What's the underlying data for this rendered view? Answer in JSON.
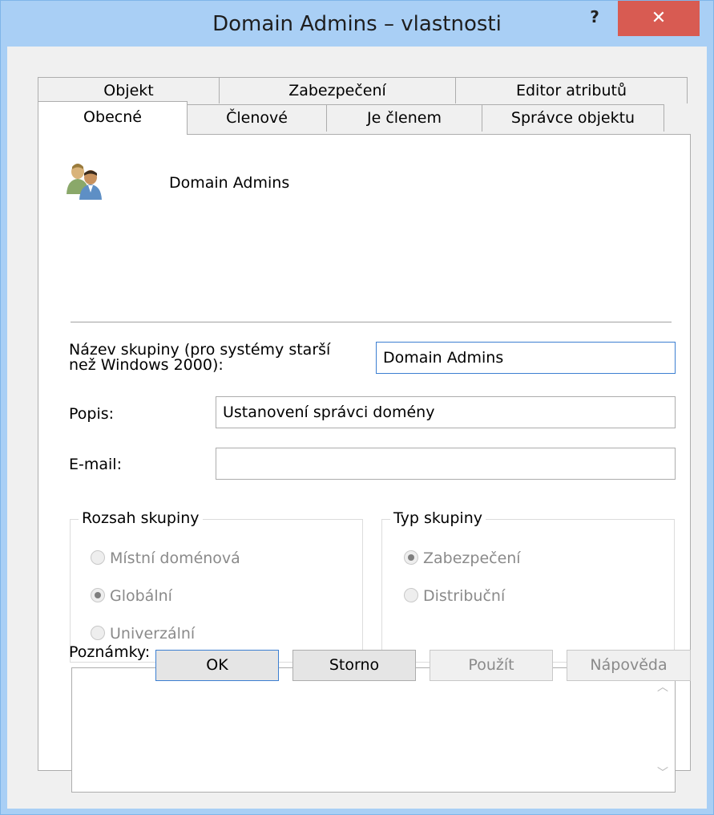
{
  "window": {
    "title": "Domain Admins – vlastnosti",
    "help_label": "?",
    "close_label": "✕"
  },
  "tabs": {
    "row1": [
      "Objekt",
      "Zabezpečení",
      "Editor atributů"
    ],
    "row2": [
      "Obecné",
      "Členové",
      "Je členem",
      "Správce objektu"
    ],
    "active": "Obecné"
  },
  "general": {
    "icon": "users-group-icon",
    "group_name": "Domain Admins",
    "prewin_label_line1": "Název skupiny (pro systémy starší",
    "prewin_label_line2": "než Windows 2000):",
    "prewin_value": "Domain Admins",
    "description_label": "Popis:",
    "description_value": "Ustanovení správci domény",
    "email_label": "E-mail:",
    "email_value": ""
  },
  "scope_group": {
    "title": "Rozsah skupiny",
    "options": [
      "Místní doménová",
      "Globální",
      "Univerzální"
    ],
    "selected": "Globální"
  },
  "type_group": {
    "title": "Typ skupiny",
    "options": [
      "Zabezpečení",
      "Distribuční"
    ],
    "selected": "Zabezpečení"
  },
  "notes": {
    "label": "Poznámky:",
    "value": ""
  },
  "buttons": {
    "ok": "OK",
    "cancel": "Storno",
    "apply": "Použít",
    "help": "Nápověda"
  },
  "colors": {
    "titlebar": "#a9cff5",
    "close": "#d85b52",
    "focus_border": "#3c7fd1"
  }
}
